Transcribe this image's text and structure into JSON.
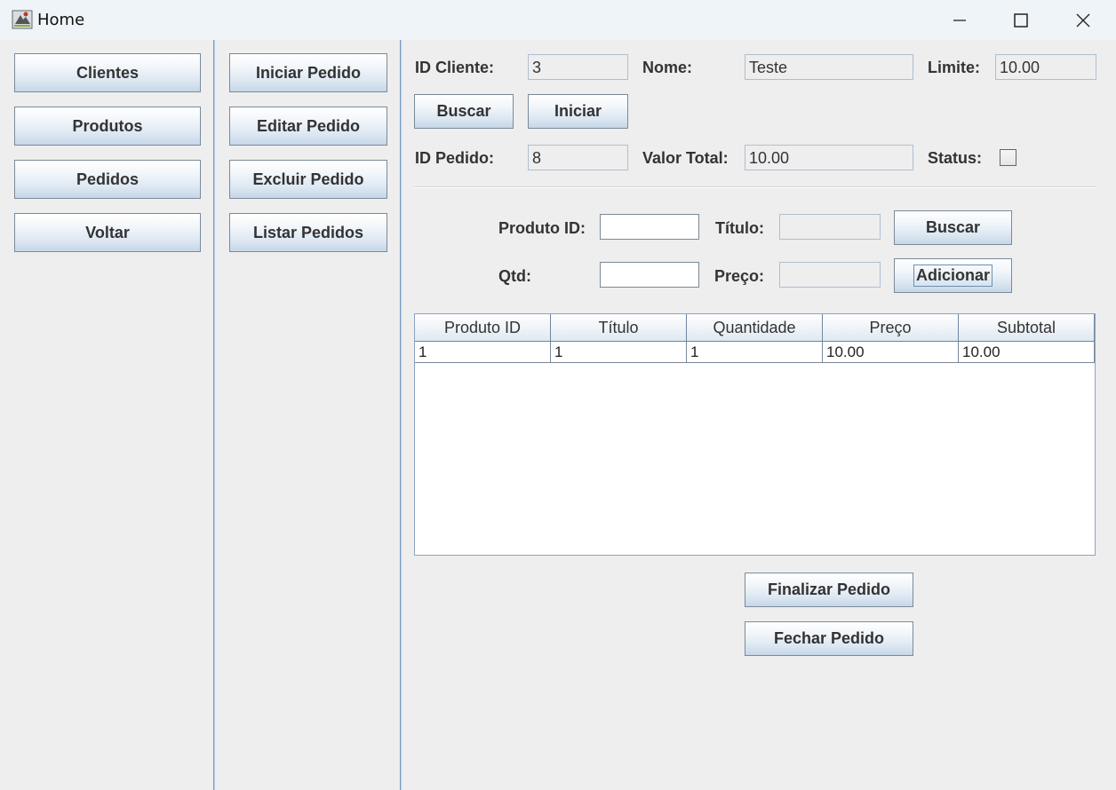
{
  "window": {
    "title": "Home"
  },
  "menu": {
    "main": [
      "Clientes",
      "Produtos",
      "Pedidos",
      "Voltar"
    ],
    "pedidos": [
      "Iniciar Pedido",
      "Editar Pedido",
      "Excluir Pedido",
      "Listar Pedidos"
    ]
  },
  "cliente": {
    "id_label": "ID Cliente:",
    "id_value": "3",
    "nome_label": "Nome:",
    "nome_value": "Teste",
    "limite_label": "Limite:",
    "limite_value": "10.00",
    "buscar_label": "Buscar",
    "iniciar_label": "Iniciar"
  },
  "pedido": {
    "id_label": "ID Pedido:",
    "id_value": "8",
    "valor_label": "Valor Total:",
    "valor_value": "10.00",
    "status_label": "Status:",
    "status_checked": false
  },
  "produto": {
    "id_label": "Produto ID:",
    "id_value": "",
    "titulo_label": "Título:",
    "titulo_value": "",
    "buscar_label": "Buscar",
    "qtd_label": "Qtd:",
    "qtd_value": "",
    "preco_label": "Preço:",
    "preco_value": "",
    "adicionar_label": "Adicionar"
  },
  "table": {
    "columns": [
      "Produto ID",
      "Título",
      "Quantidade",
      "Preço",
      "Subtotal"
    ],
    "rows": [
      [
        "1",
        "1",
        "1",
        "10.00",
        "10.00"
      ]
    ]
  },
  "actions": {
    "finalizar_label": "Finalizar Pedido",
    "fechar_label": "Fechar Pedido"
  }
}
